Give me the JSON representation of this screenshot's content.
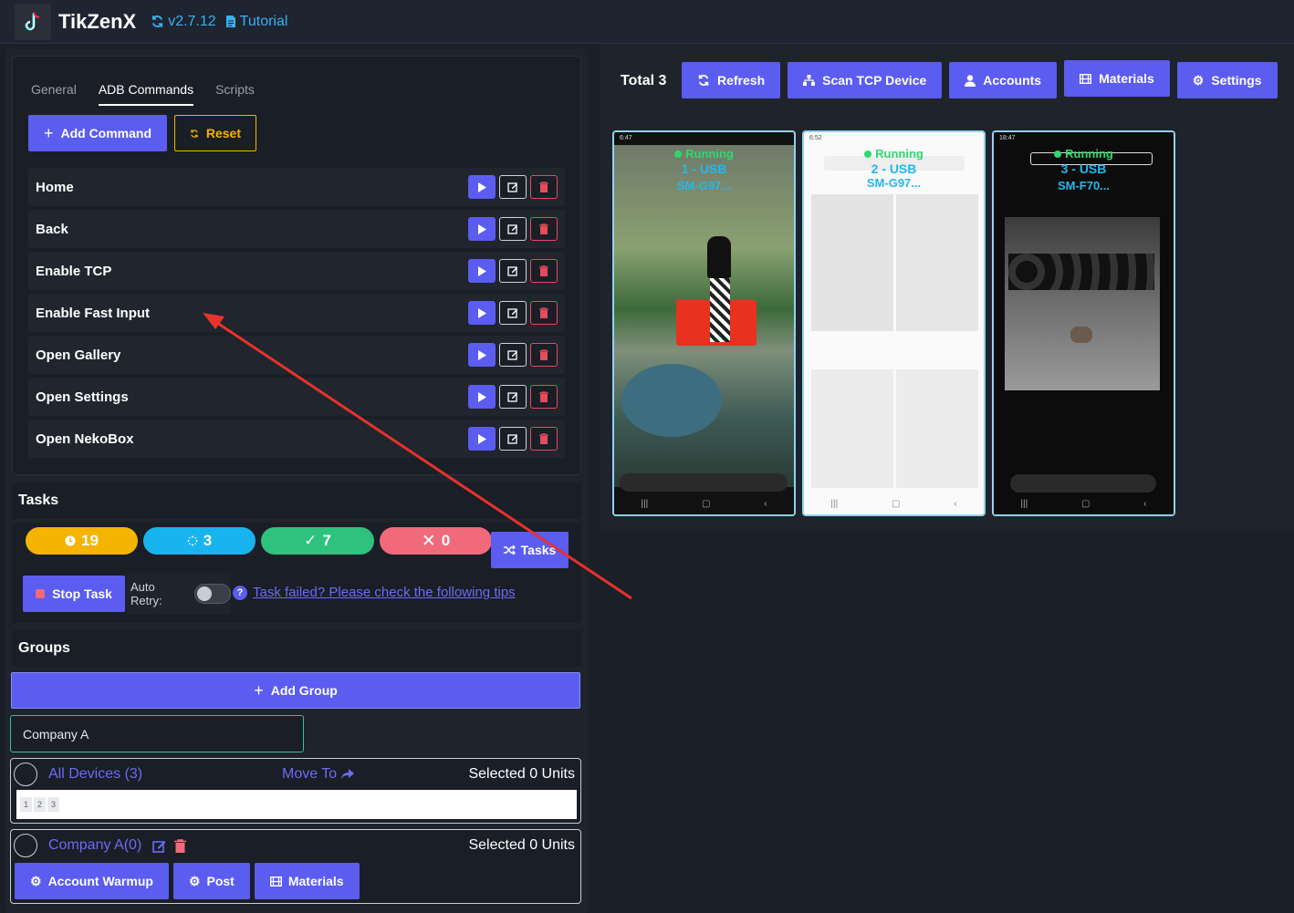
{
  "app": {
    "title": "TikZenX",
    "version": "v2.7.12",
    "tutorial": "Tutorial"
  },
  "tabs": [
    "General",
    "ADB Commands",
    "Scripts"
  ],
  "commands": {
    "add_label": "Add Command",
    "reset_label": "Reset",
    "items": [
      "Home",
      "Back",
      "Enable TCP",
      "Enable Fast Input",
      "Open Gallery",
      "Open Settings",
      "Open NekoBox"
    ]
  },
  "tasks": {
    "title": "Tasks",
    "counts": {
      "pending": "19",
      "running": "3",
      "success": "7",
      "failed": "0"
    },
    "tasks_button": "Tasks",
    "stop_button": "Stop Task",
    "auto_retry_label": "Auto Retry:",
    "tip_link": "Task failed? Please check the following tips"
  },
  "groups": {
    "title": "Groups",
    "add_group_label": "Add Group",
    "input_value": "Company A",
    "all_devices": {
      "title": "All Devices (3)",
      "move_to": "Move To",
      "selected": "Selected 0 Units",
      "chips": [
        "1",
        "2",
        "3"
      ]
    },
    "company": {
      "title": "Company A(0)",
      "selected": "Selected 0 Units",
      "actions": [
        "Account Warmup",
        "Post",
        "Materials"
      ]
    }
  },
  "devices_panel": {
    "total": "Total 3",
    "buttons": [
      "Refresh",
      "Scan TCP Device",
      "Accounts",
      "Materials",
      "Settings"
    ],
    "phones": [
      {
        "status": "Running",
        "usb": "1 - USB",
        "model": "SM-G97...",
        "time": "6:47"
      },
      {
        "status": "Running",
        "usb": "2 - USB",
        "model": "SM-G97...",
        "time": "6:52"
      },
      {
        "status": "Running",
        "usb": "3 - USB",
        "model": "SM-F70...",
        "time": "18:47"
      }
    ]
  },
  "colors": {
    "accent": "#5b5cf0",
    "warning": "#f5b400",
    "pending": "#f5b400",
    "running": "#18b4f0",
    "success": "#2ec27e",
    "failed": "#f06a7c",
    "usb": "#22b8f0",
    "running_text": "#2fd86f"
  }
}
